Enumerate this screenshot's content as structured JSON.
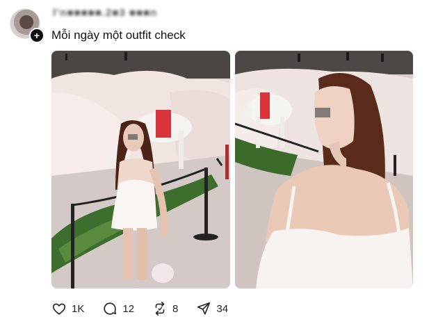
{
  "post": {
    "username": "l’n■■■■■.2■3 ■■■n",
    "caption": "Mỗi ngày một outfit check",
    "follow_glyph": "+"
  },
  "media": [
    {
      "description_icon": "photo"
    },
    {
      "description_icon": "photo"
    }
  ],
  "actions": {
    "like": {
      "icon": "heart-icon",
      "count": "1K"
    },
    "comment": {
      "icon": "comment-icon",
      "count": "12"
    },
    "repost": {
      "icon": "repost-icon",
      "count": "8"
    },
    "share": {
      "icon": "share-icon",
      "count": "34"
    }
  },
  "colors": {
    "text": "#111111",
    "icon": "#222222",
    "accent_red": "#d9343b"
  }
}
